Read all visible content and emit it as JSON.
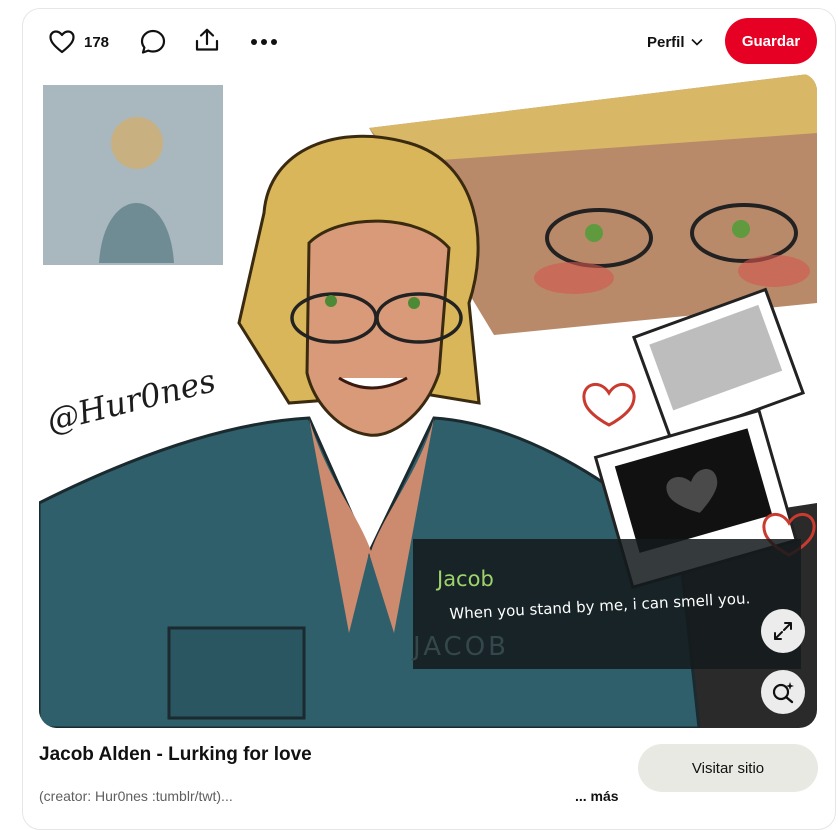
{
  "toolbar": {
    "like_count": "178",
    "profile_label": "Perfil",
    "save_label": "Guardar"
  },
  "pin": {
    "dialog_speaker": "Jacob",
    "dialog_text": "When you stand by me, i can smell you.",
    "name_badge": "JACOB",
    "signature": "@Hur0nes",
    "title": "Jacob Alden - Lurking for love",
    "description": "(creator: Hur0nes :tumblr/twt)...",
    "more_label": "... más",
    "visit_label": "Visitar sitio"
  },
  "icons": {
    "like": "heart-outline-icon",
    "comment": "comment-bubble-icon",
    "share": "share-upload-icon",
    "more": "more-dots-icon",
    "profile_dropdown": "chevron-down-icon",
    "expand": "expand-icon",
    "visual_search": "visual-search-icon"
  },
  "colors": {
    "save_button": "#e60023",
    "visit_button": "#e9e9e4",
    "shirt": "#2f5f6b",
    "hair": "#d9b65a"
  }
}
